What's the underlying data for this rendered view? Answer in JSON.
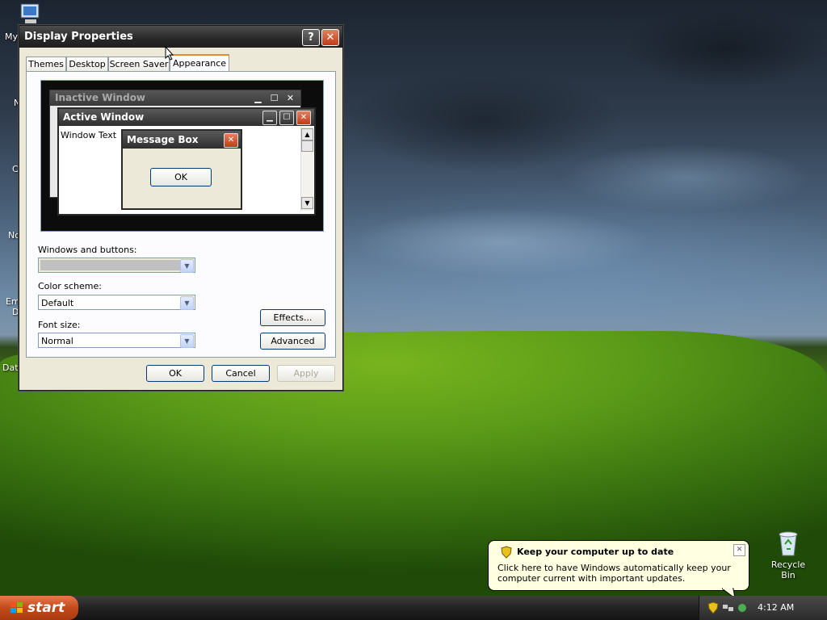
{
  "desktop": {
    "icons": [
      {
        "label": "My"
      },
      {
        "label": "N"
      },
      {
        "label": "C"
      },
      {
        "label": "No"
      },
      {
        "label": "Em"
      },
      {
        "label": "D"
      },
      {
        "label": "Dat"
      }
    ],
    "recycle_bin": "Recycle Bin"
  },
  "dialog": {
    "title": "Display Properties",
    "help": "?",
    "close": "✕",
    "tabs": [
      "Themes",
      "Desktop",
      "Screen Saver",
      "Appearance"
    ],
    "selected_tab": "Appearance",
    "preview": {
      "inactive_title": "Inactive Window",
      "active_title": "Active Window",
      "window_text": "Window Text",
      "message_title": "Message Box",
      "message_ok": "OK"
    },
    "windows_buttons_label": "Windows and buttons:",
    "windows_buttons_value": "",
    "color_scheme_label": "Color scheme:",
    "color_scheme_value": "Default",
    "font_size_label": "Font size:",
    "font_size_value": "Normal",
    "effects": "Effects...",
    "advanced": "Advanced",
    "ok": "OK",
    "cancel": "Cancel",
    "apply": "Apply"
  },
  "balloon": {
    "title": "Keep your computer up to date",
    "body": "Click here to have Windows automatically keep your computer current with important updates."
  },
  "taskbar": {
    "start": "start",
    "clock": "4:12 AM"
  }
}
